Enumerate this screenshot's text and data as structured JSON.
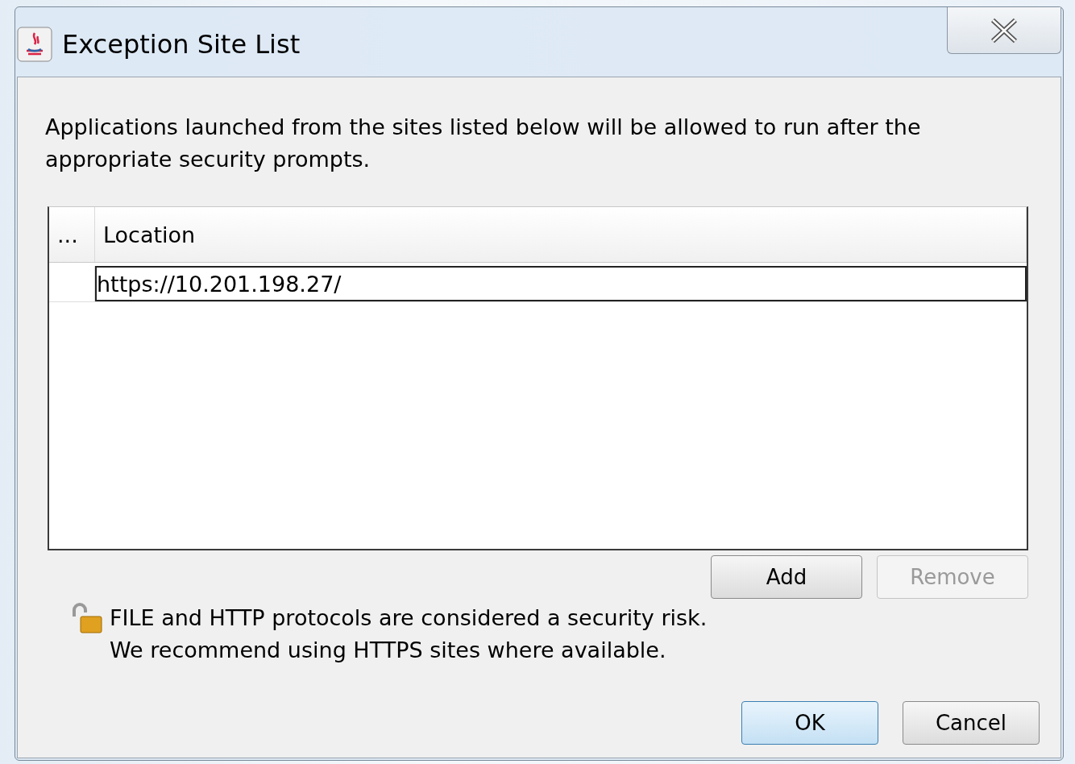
{
  "window": {
    "title": "Exception Site List"
  },
  "description": "Applications launched from the sites listed below will be allowed to run after the appropriate security prompts.",
  "table": {
    "columns": [
      "...",
      "Location"
    ],
    "rows": [
      {
        "cells": [
          "",
          "https://10.201.198.27/"
        ],
        "selected": true
      }
    ]
  },
  "list_buttons": [
    {
      "label": "Add",
      "disabled": false
    },
    {
      "label": "Remove",
      "disabled": true
    }
  ],
  "warning": [
    "FILE and HTTP protocols are considered a security risk.",
    "We recommend using HTTPS sites where available."
  ],
  "dialog_buttons": [
    {
      "label": "OK",
      "default": true
    },
    {
      "label": "Cancel",
      "default": false
    }
  ]
}
